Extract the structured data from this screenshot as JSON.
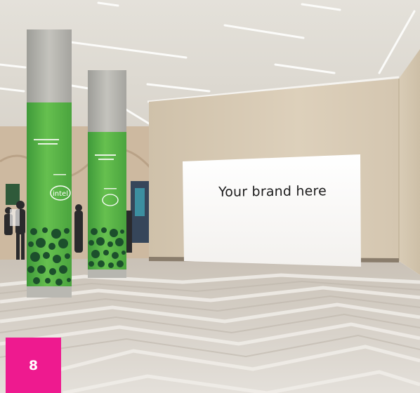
{
  "photo": {
    "billboard_text": "Your brand here",
    "pillar_logo_text": "intel"
  },
  "badge": {
    "number": "8",
    "color": "#ee1a8f"
  },
  "colors": {
    "pillar_green": "#5bb749",
    "pillar_dots": "#1c4f2c",
    "wall_beige": "#ddd0bb",
    "ceiling": "#e9e6e0",
    "floor": "#d7d1c9"
  }
}
